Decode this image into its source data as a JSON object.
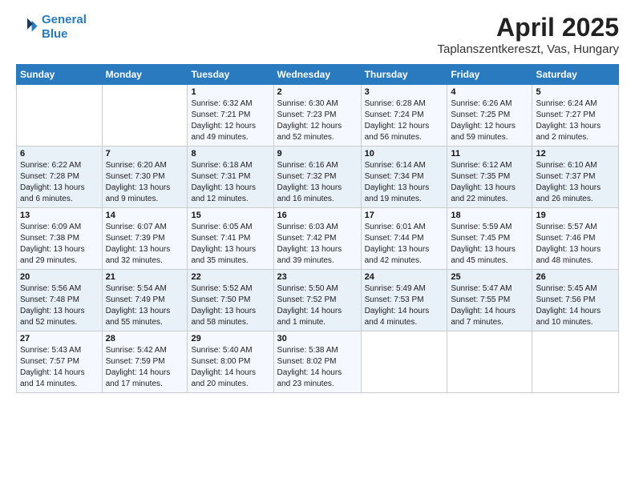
{
  "logo": {
    "line1": "General",
    "line2": "Blue"
  },
  "title": "April 2025",
  "subtitle": "Taplanszentkereszt, Vas, Hungary",
  "days_of_week": [
    "Sunday",
    "Monday",
    "Tuesday",
    "Wednesday",
    "Thursday",
    "Friday",
    "Saturday"
  ],
  "weeks": [
    [
      {
        "day": "",
        "info": ""
      },
      {
        "day": "",
        "info": ""
      },
      {
        "day": "1",
        "info": "Sunrise: 6:32 AM\nSunset: 7:21 PM\nDaylight: 12 hours and 49 minutes."
      },
      {
        "day": "2",
        "info": "Sunrise: 6:30 AM\nSunset: 7:23 PM\nDaylight: 12 hours and 52 minutes."
      },
      {
        "day": "3",
        "info": "Sunrise: 6:28 AM\nSunset: 7:24 PM\nDaylight: 12 hours and 56 minutes."
      },
      {
        "day": "4",
        "info": "Sunrise: 6:26 AM\nSunset: 7:25 PM\nDaylight: 12 hours and 59 minutes."
      },
      {
        "day": "5",
        "info": "Sunrise: 6:24 AM\nSunset: 7:27 PM\nDaylight: 13 hours and 2 minutes."
      }
    ],
    [
      {
        "day": "6",
        "info": "Sunrise: 6:22 AM\nSunset: 7:28 PM\nDaylight: 13 hours and 6 minutes."
      },
      {
        "day": "7",
        "info": "Sunrise: 6:20 AM\nSunset: 7:30 PM\nDaylight: 13 hours and 9 minutes."
      },
      {
        "day": "8",
        "info": "Sunrise: 6:18 AM\nSunset: 7:31 PM\nDaylight: 13 hours and 12 minutes."
      },
      {
        "day": "9",
        "info": "Sunrise: 6:16 AM\nSunset: 7:32 PM\nDaylight: 13 hours and 16 minutes."
      },
      {
        "day": "10",
        "info": "Sunrise: 6:14 AM\nSunset: 7:34 PM\nDaylight: 13 hours and 19 minutes."
      },
      {
        "day": "11",
        "info": "Sunrise: 6:12 AM\nSunset: 7:35 PM\nDaylight: 13 hours and 22 minutes."
      },
      {
        "day": "12",
        "info": "Sunrise: 6:10 AM\nSunset: 7:37 PM\nDaylight: 13 hours and 26 minutes."
      }
    ],
    [
      {
        "day": "13",
        "info": "Sunrise: 6:09 AM\nSunset: 7:38 PM\nDaylight: 13 hours and 29 minutes."
      },
      {
        "day": "14",
        "info": "Sunrise: 6:07 AM\nSunset: 7:39 PM\nDaylight: 13 hours and 32 minutes."
      },
      {
        "day": "15",
        "info": "Sunrise: 6:05 AM\nSunset: 7:41 PM\nDaylight: 13 hours and 35 minutes."
      },
      {
        "day": "16",
        "info": "Sunrise: 6:03 AM\nSunset: 7:42 PM\nDaylight: 13 hours and 39 minutes."
      },
      {
        "day": "17",
        "info": "Sunrise: 6:01 AM\nSunset: 7:44 PM\nDaylight: 13 hours and 42 minutes."
      },
      {
        "day": "18",
        "info": "Sunrise: 5:59 AM\nSunset: 7:45 PM\nDaylight: 13 hours and 45 minutes."
      },
      {
        "day": "19",
        "info": "Sunrise: 5:57 AM\nSunset: 7:46 PM\nDaylight: 13 hours and 48 minutes."
      }
    ],
    [
      {
        "day": "20",
        "info": "Sunrise: 5:56 AM\nSunset: 7:48 PM\nDaylight: 13 hours and 52 minutes."
      },
      {
        "day": "21",
        "info": "Sunrise: 5:54 AM\nSunset: 7:49 PM\nDaylight: 13 hours and 55 minutes."
      },
      {
        "day": "22",
        "info": "Sunrise: 5:52 AM\nSunset: 7:50 PM\nDaylight: 13 hours and 58 minutes."
      },
      {
        "day": "23",
        "info": "Sunrise: 5:50 AM\nSunset: 7:52 PM\nDaylight: 14 hours and 1 minute."
      },
      {
        "day": "24",
        "info": "Sunrise: 5:49 AM\nSunset: 7:53 PM\nDaylight: 14 hours and 4 minutes."
      },
      {
        "day": "25",
        "info": "Sunrise: 5:47 AM\nSunset: 7:55 PM\nDaylight: 14 hours and 7 minutes."
      },
      {
        "day": "26",
        "info": "Sunrise: 5:45 AM\nSunset: 7:56 PM\nDaylight: 14 hours and 10 minutes."
      }
    ],
    [
      {
        "day": "27",
        "info": "Sunrise: 5:43 AM\nSunset: 7:57 PM\nDaylight: 14 hours and 14 minutes."
      },
      {
        "day": "28",
        "info": "Sunrise: 5:42 AM\nSunset: 7:59 PM\nDaylight: 14 hours and 17 minutes."
      },
      {
        "day": "29",
        "info": "Sunrise: 5:40 AM\nSunset: 8:00 PM\nDaylight: 14 hours and 20 minutes."
      },
      {
        "day": "30",
        "info": "Sunrise: 5:38 AM\nSunset: 8:02 PM\nDaylight: 14 hours and 23 minutes."
      },
      {
        "day": "",
        "info": ""
      },
      {
        "day": "",
        "info": ""
      },
      {
        "day": "",
        "info": ""
      }
    ]
  ]
}
